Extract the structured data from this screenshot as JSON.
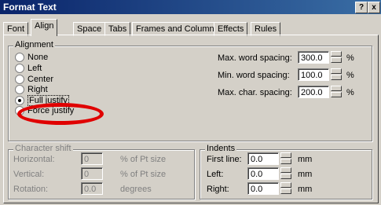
{
  "window": {
    "title": "Format Text",
    "help_btn": "?",
    "close_btn": "x"
  },
  "tabs": [
    "Font",
    "Align",
    "Space",
    "Tabs",
    "Frames and Columns",
    "Effects",
    "Rules"
  ],
  "alignment": {
    "title": "Alignment",
    "options": [
      "None",
      "Left",
      "Center",
      "Right",
      "Full justify",
      "Force justify"
    ],
    "selected": "Full justify"
  },
  "spacing": {
    "max_word_label": "Max. word spacing:",
    "max_word_value": "300.0",
    "max_word_unit": "%",
    "min_word_label": "Min. word spacing:",
    "min_word_value": "100.0",
    "min_word_unit": "%",
    "max_char_label": "Max. char. spacing:",
    "max_char_value": "200.0",
    "max_char_unit": "%"
  },
  "char_shift": {
    "title": "Character shift",
    "horizontal_label": "Horizontal:",
    "horizontal_value": "0",
    "horizontal_unit": "% of Pt size",
    "vertical_label": "Vertical:",
    "vertical_value": "0",
    "vertical_unit": "% of Pt size",
    "rotation_label": "Rotation:",
    "rotation_value": "0.0",
    "rotation_unit": "degrees"
  },
  "indents": {
    "title": "Indents",
    "first_label": "First line:",
    "first_value": "0.0",
    "first_unit": "mm",
    "left_label": "Left:",
    "left_value": "0.0",
    "left_unit": "mm",
    "right_label": "Right:",
    "right_value": "0.0",
    "right_unit": "mm"
  },
  "colors": {
    "annotation": "#e00000",
    "titlebar": "#0a246a"
  }
}
